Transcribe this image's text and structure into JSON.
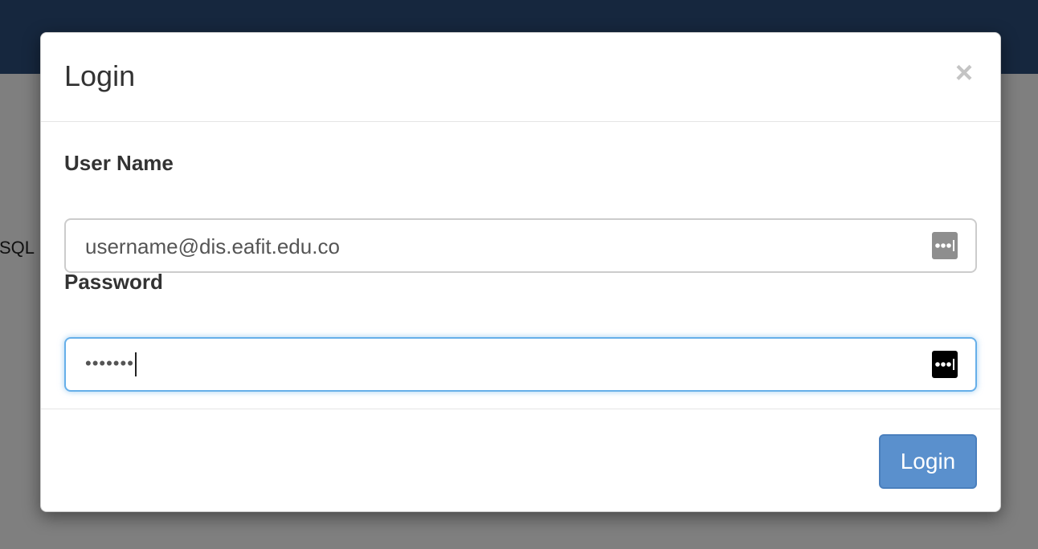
{
  "background": {
    "partial_text": "SQL",
    "topbar_color": "#2c4f7c"
  },
  "modal": {
    "title": "Login",
    "close_icon": "close-icon",
    "close_glyph": "×",
    "fields": {
      "username": {
        "label": "User Name",
        "value": "username@dis.eafit.edu.co",
        "icon": "password-manager-icon"
      },
      "password": {
        "label": "Password",
        "masked_value": "•••••••",
        "icon": "password-manager-icon",
        "focused": true
      }
    },
    "footer": {
      "login_label": "Login"
    }
  },
  "colors": {
    "accent": "#5a90cd",
    "focus_ring": "#66afe9"
  }
}
